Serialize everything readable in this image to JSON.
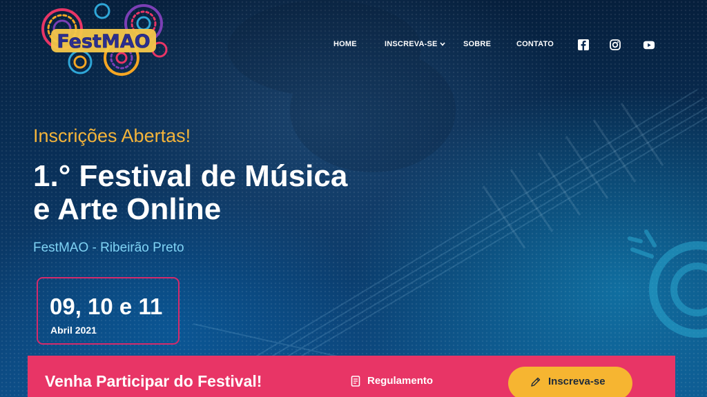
{
  "brand": {
    "logo_text": "FestMAO",
    "logo_colors": [
      "#f5a623",
      "#e83566",
      "#7b3fb5",
      "#2fa7d8"
    ]
  },
  "nav": {
    "items": [
      {
        "label": "HOME"
      },
      {
        "label": "INSCREVA-SE",
        "has_dropdown": true
      },
      {
        "label": "SOBRE"
      },
      {
        "label": "CONTATO"
      }
    ],
    "social": [
      {
        "icon": "facebook-icon"
      },
      {
        "icon": "instagram-icon"
      },
      {
        "icon": "youtube-icon"
      }
    ]
  },
  "hero": {
    "eyebrow": "Inscrições Abertas!",
    "title_line1": "1.° Festival de Música",
    "title_line2": "e Arte Online",
    "subtitle": "FestMAO - Ribeirão Preto",
    "date_days": "09, 10 e 11",
    "date_month": "Abril 2021"
  },
  "cta": {
    "title": "Venha Participar do Festival!",
    "regulamento_label": "Regulamento",
    "regulamento_icon": "document-icon",
    "button_label": "Inscreva-se",
    "button_icon": "pencil-icon"
  },
  "colors": {
    "accent_yellow": "#f6b531",
    "accent_pink": "#e83566",
    "subtitle_blue": "#7fd3f4",
    "background_navy": "#0a2a52"
  }
}
